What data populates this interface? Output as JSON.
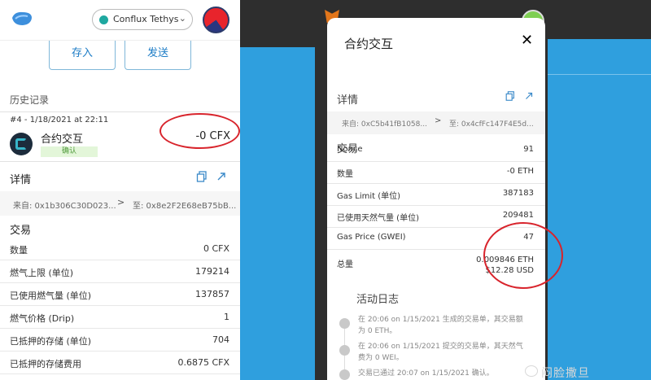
{
  "left": {
    "network": "Conflux Tethys",
    "buttons": {
      "deposit": "存入",
      "send": "发送"
    },
    "history_label": "历史记录",
    "tx": {
      "meta": "#4 - 1/18/2021 at 22:11",
      "title": "合约交互",
      "status": "确认",
      "amount": "-0 CFX"
    },
    "details_label": "详情",
    "from": "来自: 0x1b306C30D023...",
    "to": "至: 0x8e2F2E68eB75bB...",
    "tx_section": "交易",
    "rows": [
      {
        "k": "数量",
        "v": "0 CFX"
      },
      {
        "k": "燃气上限 (单位)",
        "v": "179214"
      },
      {
        "k": "已使用燃气量 (单位)",
        "v": "137857"
      },
      {
        "k": "燃气价格 (Drip)",
        "v": "1"
      },
      {
        "k": "已抵押的存储 (单位)",
        "v": "704"
      },
      {
        "k": "已抵押的存储费用",
        "v": "0.6875 CFX"
      }
    ]
  },
  "right": {
    "title": "合约交互",
    "close": "✕",
    "details_label": "详情",
    "from": "来自: 0xC5b41fB1058...",
    "to": "至: 0x4cfFc147F4E5d...",
    "tx_section": "交易",
    "rows": [
      {
        "k": "Nonce",
        "v": "91"
      },
      {
        "k": "数量",
        "v": "-0 ETH"
      },
      {
        "k": "Gas Limit (单位)",
        "v": "387183"
      },
      {
        "k": "已使用天然气量 (单位)",
        "v": "209481"
      },
      {
        "k": "Gas Price (GWEI)",
        "v": "47"
      },
      {
        "k": "总量",
        "v": "0.009846 ETH",
        "v2": "$12.28 USD"
      }
    ],
    "log_title": "活动日志",
    "log": [
      {
        "line1": "在 20:06 on 1/15/2021 生成的交易单，其交易额",
        "line2": "为 0 ETH。"
      },
      {
        "line1": "在 20:06 on 1/15/2021 提交的交易单，其天然气",
        "line2": "费为 0 WEI。"
      },
      {
        "line1": "交易已通过 20:07 on 1/15/2021 确认。",
        "line2": ""
      }
    ]
  },
  "watermark": "闷脸撒旦",
  "colors": {
    "accent_blue": "#1c7cc6",
    "highlight_red": "#d8242c",
    "bg_blue": "#2f9fde"
  }
}
